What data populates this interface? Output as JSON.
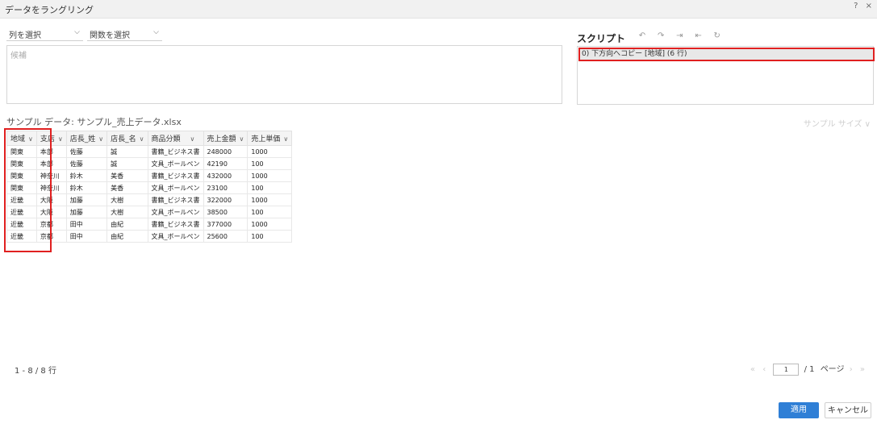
{
  "dialog": {
    "title": "データをラングリング",
    "help": "?",
    "close": "×"
  },
  "selectors": {
    "column": {
      "label": "列を選択",
      "chevron": "chevron-down-icon"
    },
    "function": {
      "label": "関数を選択",
      "chevron": "chevron-down-icon"
    }
  },
  "candidates": {
    "placeholder": "候補"
  },
  "script": {
    "heading": "スクリプト",
    "tools": {
      "undo": "↶",
      "redo": "↷",
      "export": "⇥",
      "import": "⇤",
      "reset": "↻"
    },
    "steps": [
      "0) 下方向へコピー [地域] (6 行)"
    ]
  },
  "sample": {
    "title": "サンプル データ: サンプル_売上データ.xlsx",
    "size_label": "サンプル サイズ ∨"
  },
  "table": {
    "columns": [
      "地域",
      "支店",
      "店長_姓",
      "店長_名",
      "商品分類",
      "売上金額",
      "売上単価"
    ],
    "rows": [
      [
        "関東",
        "本部",
        "佐藤",
        "誠",
        "書籍_ビジネス書",
        "248000",
        "1000"
      ],
      [
        "関東",
        "本部",
        "佐藤",
        "誠",
        "文具_ボールペン",
        "42190",
        "100"
      ],
      [
        "関東",
        "神奈川",
        "鈴木",
        "美香",
        "書籍_ビジネス書",
        "432000",
        "1000"
      ],
      [
        "関東",
        "神奈川",
        "鈴木",
        "美香",
        "文具_ボールペン",
        "23100",
        "100"
      ],
      [
        "近畿",
        "大阪",
        "加藤",
        "大樹",
        "書籍_ビジネス書",
        "322000",
        "1000"
      ],
      [
        "近畿",
        "大阪",
        "加藤",
        "大樹",
        "文具_ボールペン",
        "38500",
        "100"
      ],
      [
        "近畿",
        "京都",
        "田中",
        "由紀",
        "書籍_ビジネス書",
        "377000",
        "1000"
      ],
      [
        "近畿",
        "京都",
        "田中",
        "由紀",
        "文具_ボールペン",
        "25600",
        "100"
      ]
    ]
  },
  "footer": {
    "row_count": "1 - 8 / 8 行",
    "pager": {
      "first": "«",
      "prev": "‹",
      "page": "1",
      "total": "/ 1",
      "page_label": "ページ",
      "next": "›",
      "last": "»"
    }
  },
  "buttons": {
    "apply": "適用",
    "cancel": "キャンセル"
  },
  "colors": {
    "accent": "#2f7fd6",
    "highlight": "#e02020"
  }
}
